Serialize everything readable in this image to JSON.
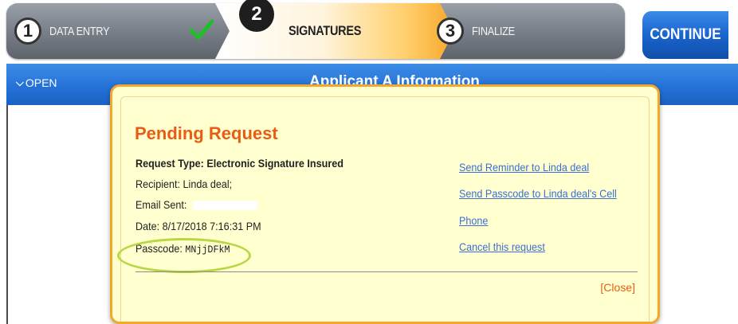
{
  "wizard": {
    "steps": [
      {
        "number": "1",
        "label": "DATA ENTRY"
      },
      {
        "number": "2",
        "label": "SIGNATURES"
      },
      {
        "number": "3",
        "label": "FINALIZE"
      }
    ],
    "completed_icon": "checkmark-icon",
    "continue_label": "CONTINUE"
  },
  "section": {
    "toggle_label": "OPEN",
    "toggle_icon": "double-chevron-down-icon",
    "title": "Applicant A Information"
  },
  "modal": {
    "title": "Pending Request",
    "request_type": "Request Type: Electronic Signature Insured",
    "recipient": "Recipient: Linda deal;",
    "email_sent_label": "Email Sent:",
    "date": "Date: 8/17/2018 7:16:31 PM",
    "passcode_label": "Passcode:",
    "passcode_value": "MNjjDFkM",
    "links": {
      "reminder": "Send Reminder to Linda deal",
      "passcode_cell": "Send Passcode to Linda deal's Cell",
      "phone": "Phone",
      "cancel": "Cancel this request"
    },
    "close_label": "[Close]"
  },
  "colors": {
    "accent_blue": "#2370d6",
    "modal_border": "#f3a82c",
    "modal_bg": "#ffffd0",
    "title_orange": "#e85d13",
    "link_blue": "#3b6fd6",
    "highlight_green": "#b6d843"
  }
}
